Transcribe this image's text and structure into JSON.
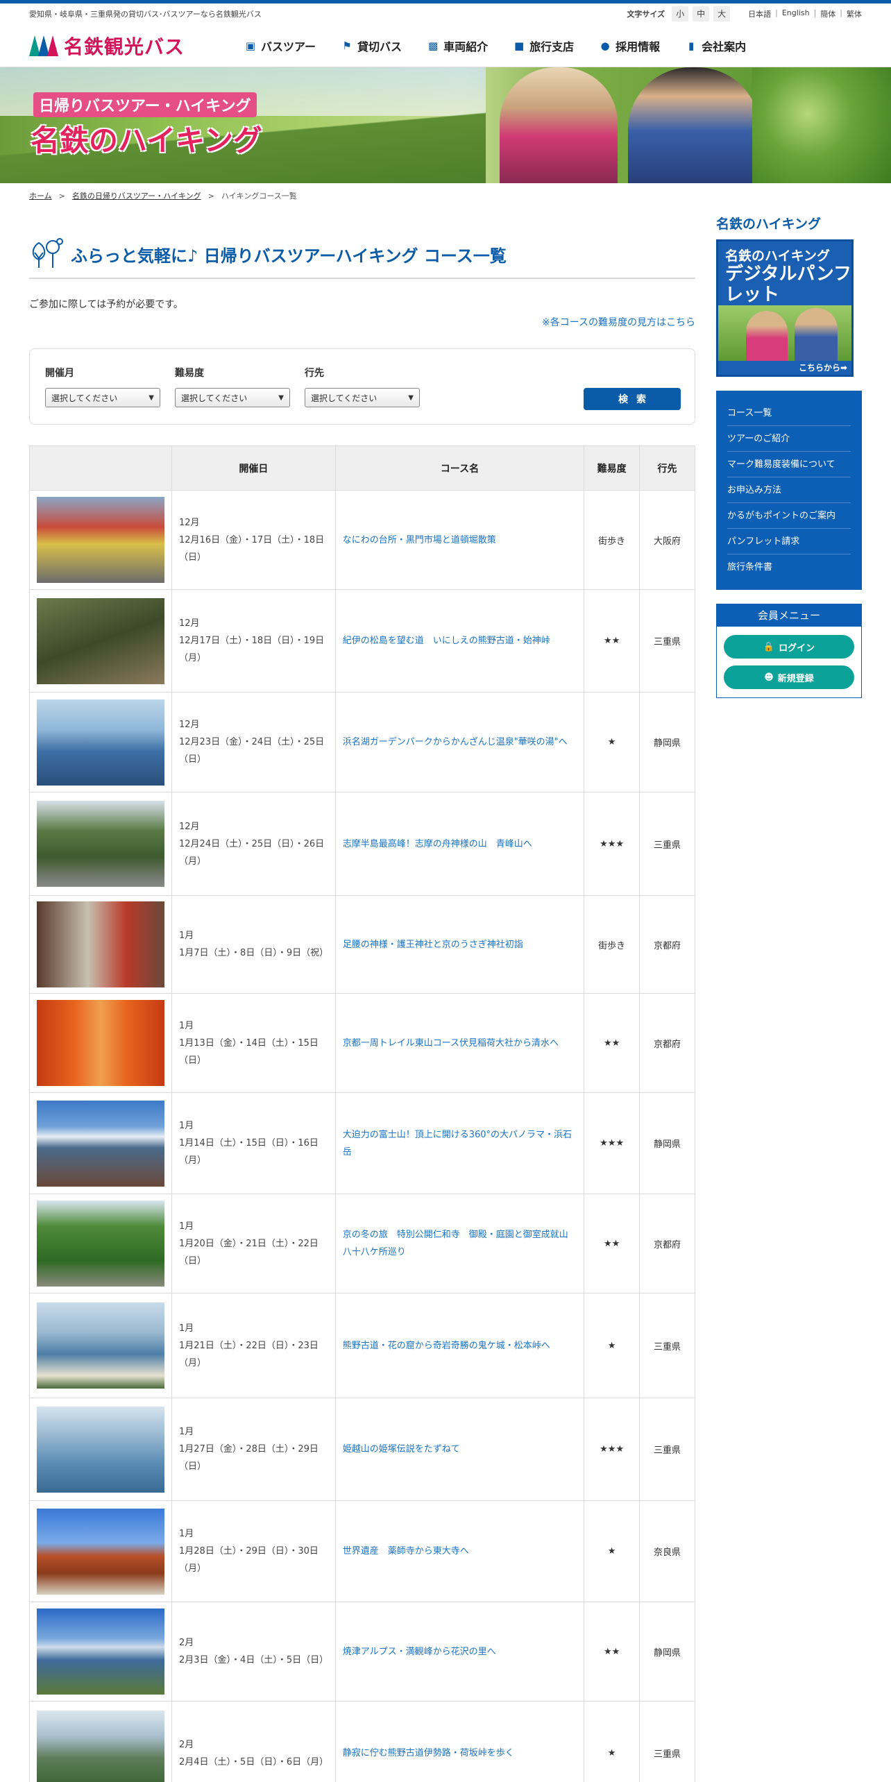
{
  "topbar": {
    "tagline": "愛知県・岐阜県・三重県発の貸切バス･バスツアーなら名鉄観光バス",
    "fontsize_label": "文字サイズ",
    "fontsize": [
      "小",
      "中",
      "大"
    ],
    "languages": [
      "日本語",
      "English",
      "簡体",
      "繁体"
    ]
  },
  "header": {
    "logo_text": "名鉄観光バス",
    "nav": [
      {
        "label": "バスツアー",
        "icon": "bus-icon"
      },
      {
        "label": "貸切バス",
        "icon": "flag-icon"
      },
      {
        "label": "車両紹介",
        "icon": "coach-icon"
      },
      {
        "label": "旅行支店",
        "icon": "briefcase-icon"
      },
      {
        "label": "採用情報",
        "icon": "people-icon"
      },
      {
        "label": "会社案内",
        "icon": "building-icon"
      }
    ]
  },
  "hero": {
    "subtitle": "日帰りバスツアー・ハイキング",
    "title": "名鉄のハイキング"
  },
  "breadcrumb": [
    "ホーム",
    "名鉄の日帰りバスツアー・ハイキング",
    "ハイキングコース一覧"
  ],
  "main": {
    "heading": "ふらっと気軽に♪ 日帰りバスツアーハイキング コース一覧",
    "notice": "ご参加に際しては予約が必要です。",
    "difficulty_link": "※各コースの難易度の見方はこちら",
    "search": {
      "month_label": "開催月",
      "difficulty_label": "難易度",
      "destination_label": "行先",
      "select_placeholder": "選択してください",
      "button": "検索"
    },
    "table_headers": [
      "",
      "開催日",
      "コース名",
      "難易度",
      "行先"
    ],
    "courses": [
      {
        "month": "12月",
        "dates": "12月16日（金）・17日（土）・18日（日）",
        "name": "なにわの台所・黒門市場と道頓堀散策",
        "difficulty": "街歩き",
        "dest": "大阪府",
        "photo": "city"
      },
      {
        "month": "12月",
        "dates": "12月17日（土）・18日（日）・19日（月）",
        "name": "紀伊の松島を望む道　いにしえの熊野古道・始神峠",
        "difficulty": "★★",
        "dest": "三重県",
        "photo": "forest"
      },
      {
        "month": "12月",
        "dates": "12月23日（金）・24日（土）・25日（日）",
        "name": "浜名湖ガーデンパークからかんざんじ温泉\"華咲の湯\"へ",
        "difficulty": "★",
        "dest": "静岡県",
        "photo": "lake"
      },
      {
        "month": "12月",
        "dates": "12月24日（土）・25日（日）・26日（月）",
        "name": "志摩半島最高峰！志摩の舟神様の山　青峰山へ",
        "difficulty": "★★★",
        "dest": "三重県",
        "photo": "temple"
      },
      {
        "month": "1月",
        "dates": "1月7日（土）・8日（日）・9日（祝）",
        "name": "足腰の神様・護王神社と京のうさぎ神社初詣",
        "difficulty": "街歩き",
        "dest": "京都府",
        "photo": "shrine"
      },
      {
        "month": "1月",
        "dates": "1月13日（金）・14日（土）・15日（日）",
        "name": "京都一周トレイル東山コース伏見稲荷大社から清水へ",
        "difficulty": "★★",
        "dest": "京都府",
        "photo": "torii"
      },
      {
        "month": "1月",
        "dates": "1月14日（土）・15日（日）・16日（月）",
        "name": "大迫力の富士山！頂上に開ける360°の大パノラマ・浜石岳",
        "difficulty": "★★★",
        "dest": "静岡県",
        "photo": "fuji"
      },
      {
        "month": "1月",
        "dates": "1月20日（金）・21日（土）・22日（日）",
        "name": "京の冬の旅　特別公開仁和寺　御殿・庭園と御室成就山八十八ケ所巡り",
        "difficulty": "★★",
        "dest": "京都府",
        "photo": "hills"
      },
      {
        "month": "1月",
        "dates": "1月21日（土）・22日（日）・23日（月）",
        "name": "熊野古道・花の窟から奇岩奇勝の鬼ケ城・松本峠へ",
        "difficulty": "★",
        "dest": "三重県",
        "photo": "coast"
      },
      {
        "month": "1月",
        "dates": "1月27日（金）・28日（土）・29日（日）",
        "name": "姫越山の姫塚伝説をたずねて",
        "difficulty": "★★★",
        "dest": "三重県",
        "photo": "bay"
      },
      {
        "month": "1月",
        "dates": "1月28日（土）・29日（日）・30日（月）",
        "name": "世界遺産　薬師寺から東大寺へ",
        "difficulty": "★",
        "dest": "奈良県",
        "photo": "pagoda"
      },
      {
        "month": "2月",
        "dates": "2月3日（金）・4日（土）・5日（日）",
        "name": "焼津アルプス・満観峰から花沢の里へ",
        "difficulty": "★★",
        "dest": "静岡県",
        "photo": "fuji2"
      },
      {
        "month": "2月",
        "dates": "2月4日（土）・5日（日）・6日（月）",
        "name": "静寂に佇む熊野古道伊勢路・荷坂峠を歩く",
        "difficulty": "★",
        "dest": "三重県",
        "photo": "valley"
      }
    ]
  },
  "sidebar": {
    "title": "名鉄のハイキング",
    "pamphlet_line1": "名鉄のハイキング",
    "pamphlet_line2": "デジタルパンフレット",
    "pamphlet_more": "こちらから➡",
    "menu": [
      "コース一覧",
      "ツアーのご紹介",
      "マーク難易度装備について",
      "お申込み方法",
      "かるがもポイントのご案内",
      "パンフレット請求",
      "旅行条件書"
    ],
    "member_title": "会員メニュー",
    "login": "ログイン",
    "register": "新規登録"
  },
  "colors": {
    "brand_blue": "#0a5ba8",
    "link_blue": "#1a73c7",
    "logo_pink": "#d4145a",
    "member_teal": "#0ba399"
  }
}
